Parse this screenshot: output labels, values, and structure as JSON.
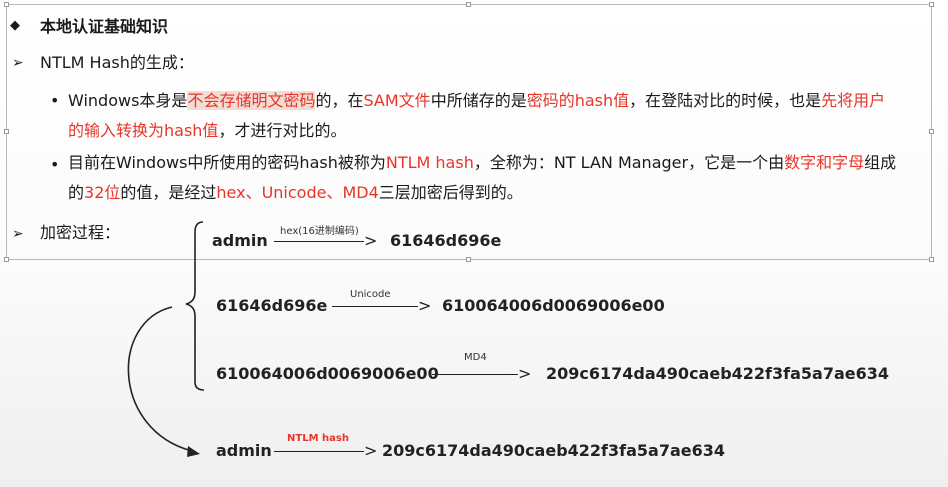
{
  "heading": {
    "marker": "◆",
    "text": "本地认证基础知识"
  },
  "section1": {
    "marker": "➢",
    "text": "NTLM Hash的生成："
  },
  "bullet_dot": "•",
  "para1": {
    "line1": [
      {
        "t": "Windows本身是"
      },
      {
        "t": "不会存储明文密码",
        "red": true,
        "hl": true
      },
      {
        "t": "的，在"
      },
      {
        "t": "SAM文件",
        "red": true
      },
      {
        "t": "中所储存的是"
      },
      {
        "t": "密码的hash值",
        "red": true
      },
      {
        "t": "，在登陆对比的时候，也是"
      },
      {
        "t": "先将用户",
        "red": true
      }
    ],
    "line2": [
      {
        "t": "的输入转换为hash值",
        "red": true
      },
      {
        "t": "，才进行对比的。"
      }
    ]
  },
  "para2": {
    "line1": [
      {
        "t": "目前在Windows中所使用的密码hash被称为"
      },
      {
        "t": "NTLM hash",
        "red": true
      },
      {
        "t": "，全称为：NT LAN Manager，它是一个由"
      },
      {
        "t": "数字和字母",
        "red": true
      },
      {
        "t": "组成"
      }
    ],
    "line2": [
      {
        "t": "的"
      },
      {
        "t": "32位",
        "red": true
      },
      {
        "t": "的值，是经过"
      },
      {
        "t": "hex、Unicode、MD4",
        "red": true
      },
      {
        "t": "三层加密后得到的。"
      }
    ]
  },
  "section2": {
    "marker": "➢",
    "text": "加密过程："
  },
  "process": {
    "step1": {
      "input": "admin",
      "label": "hex(16进制编码)",
      "output": "61646d696e"
    },
    "step2": {
      "input": "61646d696e",
      "label": "Unicode",
      "output": "610064006d0069006e00"
    },
    "step3": {
      "input": "610064006d0069006e00",
      "label": "MD4",
      "output": "209c6174da490caeb422f3fa5a7ae634"
    },
    "result": {
      "input": "admin",
      "label": "NTLM hash",
      "output": "209c6174da490caeb422f3fa5a7ae634"
    }
  },
  "colors": {
    "accent": "#e8352a",
    "highlight": "#f2dcd4",
    "text": "#1a1a1a"
  }
}
